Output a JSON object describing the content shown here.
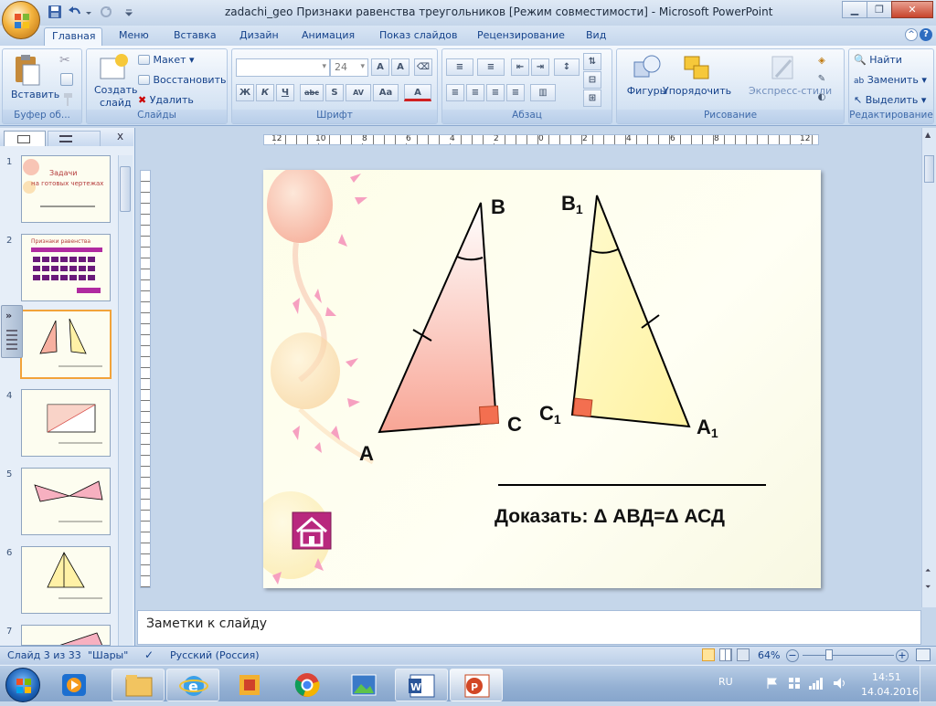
{
  "window": {
    "title": "zadachi_geo Признаки равенства треугольников [Режим совместимости] - Microsoft PowerPoint"
  },
  "tabs": [
    "Главная",
    "Меню",
    "Вставка",
    "Дизайн",
    "Анимация",
    "Показ слайдов",
    "Рецензирование",
    "Вид"
  ],
  "ribbon": {
    "clipboard": {
      "paste": "Вставить",
      "group": "Буфер об..."
    },
    "slides": {
      "create": "Создать",
      "create2": "слайд",
      "layout": "Макет",
      "reset": "Восстановить",
      "delete": "Удалить",
      "group": "Слайды"
    },
    "font": {
      "size": "24",
      "group": "Шрифт"
    },
    "paragraph": {
      "group": "Абзац"
    },
    "drawing": {
      "shapes": "Фигуры",
      "arrange": "Упорядочить",
      "styles": "Экспресс-стили",
      "group": "Рисование"
    },
    "editing": {
      "find": "Найти",
      "replace": "Заменить",
      "select": "Выделить",
      "group": "Редактирование"
    }
  },
  "ruler": {
    "ticks": [
      "12",
      "10",
      "8",
      "6",
      "4",
      "2",
      "0",
      "2",
      "4",
      "6",
      "8",
      "12"
    ]
  },
  "thumbnails": {
    "numbers": [
      "1",
      "2",
      "3",
      "4",
      "5",
      "6",
      "7"
    ],
    "slide1_title1": "Задачи",
    "slide1_title2": "на готовых чертежах",
    "slide2_title": "Признаки равенства"
  },
  "slide": {
    "labels": {
      "A": "A",
      "B": "B",
      "C": "C",
      "B1": "B",
      "C1": "C",
      "A1": "A",
      "sub": "1"
    },
    "prove": "Доказать: Δ АВД=Δ АСД"
  },
  "notes": {
    "placeholder": "Заметки к слайду"
  },
  "status": {
    "slide": "Слайд 3 из 33",
    "theme": "\"Шары\"",
    "lang": "Русский (Россия)",
    "zoom": "64%"
  },
  "taskbar": {
    "lang": "RU",
    "time": "14:51",
    "date": "14.04.2016"
  },
  "colors": {
    "triangle1": "#f5a090",
    "triangle2": "#fff5a0",
    "rightangle": "#f36f50",
    "home": "#b8287e"
  }
}
